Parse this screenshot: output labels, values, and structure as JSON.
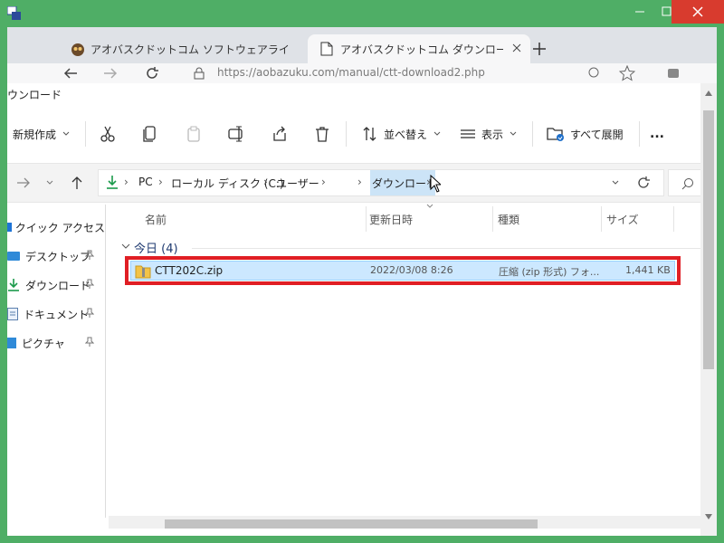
{
  "browser": {
    "tabs": [
      {
        "label": "アオバスクドットコム ソフトウェアライブラ"
      },
      {
        "label": "アオバスクドットコム ダウンロード有難う"
      }
    ],
    "url": "https://aobazuku.com/manual/ctt-download2.php"
  },
  "explorer": {
    "title": "ウンロード",
    "toolbar": {
      "new": "新規作成",
      "sort": "並べ替え",
      "view": "表示",
      "expand_all": "すべて展開",
      "more": "..."
    },
    "breadcrumb": [
      "PC",
      "ローカル ディスク (C:)",
      "ユーザー",
      "ダウンロード"
    ],
    "sidebar": [
      {
        "label": "クイック アクセス",
        "icon": "star-icon"
      },
      {
        "label": "デスクトップ",
        "icon": "desktop-icon",
        "pinned": true
      },
      {
        "label": "ダウンロード",
        "icon": "download-icon",
        "pinned": true
      },
      {
        "label": "ドキュメント",
        "icon": "document-icon",
        "pinned": true
      },
      {
        "label": "ピクチャ",
        "icon": "picture-icon",
        "pinned": true
      }
    ],
    "columns": {
      "name": "名前",
      "modified": "更新日時",
      "type": "種類",
      "size": "サイズ"
    },
    "group": "今日 (4)",
    "files": [
      {
        "name": "CTT202C.zip",
        "modified": "2022/03/08 8:26",
        "type": "圧縮 (zip 形式) フォ...",
        "size": "1,441 KB"
      }
    ]
  },
  "colors": {
    "window_frame": "#4fae66",
    "close_button": "#d83b2e",
    "highlight_box": "#e01e24",
    "selection": "#cce8ff"
  }
}
